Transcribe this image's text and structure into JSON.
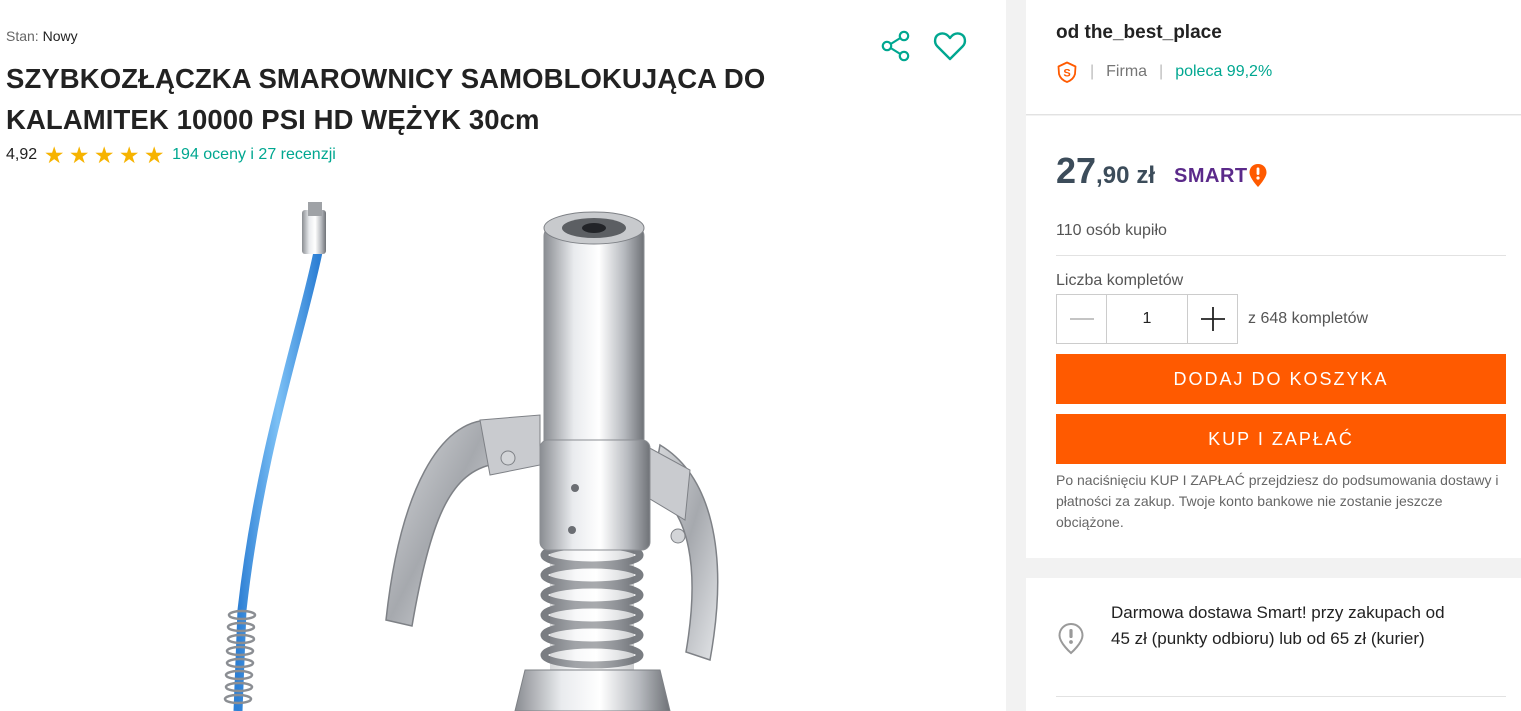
{
  "product": {
    "condition_label": "Stan:",
    "condition_value": "Nowy",
    "title": "SZYBKOZŁĄCZKA SMAROWNICY SAMOBLOKUJĄCA DO KALAMITEK 10000 PSI HD WĘŻYK 30cm",
    "rating_score": "4,92",
    "rating_stars": 5,
    "reviews_link": "194 oceny i 27 recenzji",
    "image_icon": "grease-coupler-product-photo"
  },
  "actions": {
    "share_icon": "share-icon",
    "favorite_icon": "heart-icon"
  },
  "seller": {
    "name": "od the_best_place",
    "badge_icon": "super-seller-badge-icon",
    "type": "Firma",
    "recommend": "poleca 99,2%"
  },
  "offer": {
    "price_int": "27",
    "price_frac": ",90",
    "currency": "zł",
    "smart_label": "SMART",
    "bought": "110 osób kupiło",
    "quantity_label": "Liczba kompletów",
    "quantity_value": "1",
    "quantity_of": "z 648 kompletów",
    "add_to_cart": "DODAJ DO KOSZYKA",
    "buy_now": "KUP I ZAPŁAĆ",
    "buy_note": "Po naciśnięciu KUP I ZAPŁAĆ przejdziesz do podsumowania dostawy i płatności za zakup. Twoje konto bankowe nie zostanie jeszcze obciążone."
  },
  "shipping": {
    "icon": "smart-delivery-icon",
    "text": "Darmowa dostawa Smart! przy zakupach od 45 zł (punkty odbioru) lub od 65 zł (kurier)"
  },
  "colors": {
    "accent_orange": "#ff5a00",
    "link_teal": "#00a790",
    "star_yellow": "#f6b300",
    "smart_purple": "#5b2a8a"
  }
}
